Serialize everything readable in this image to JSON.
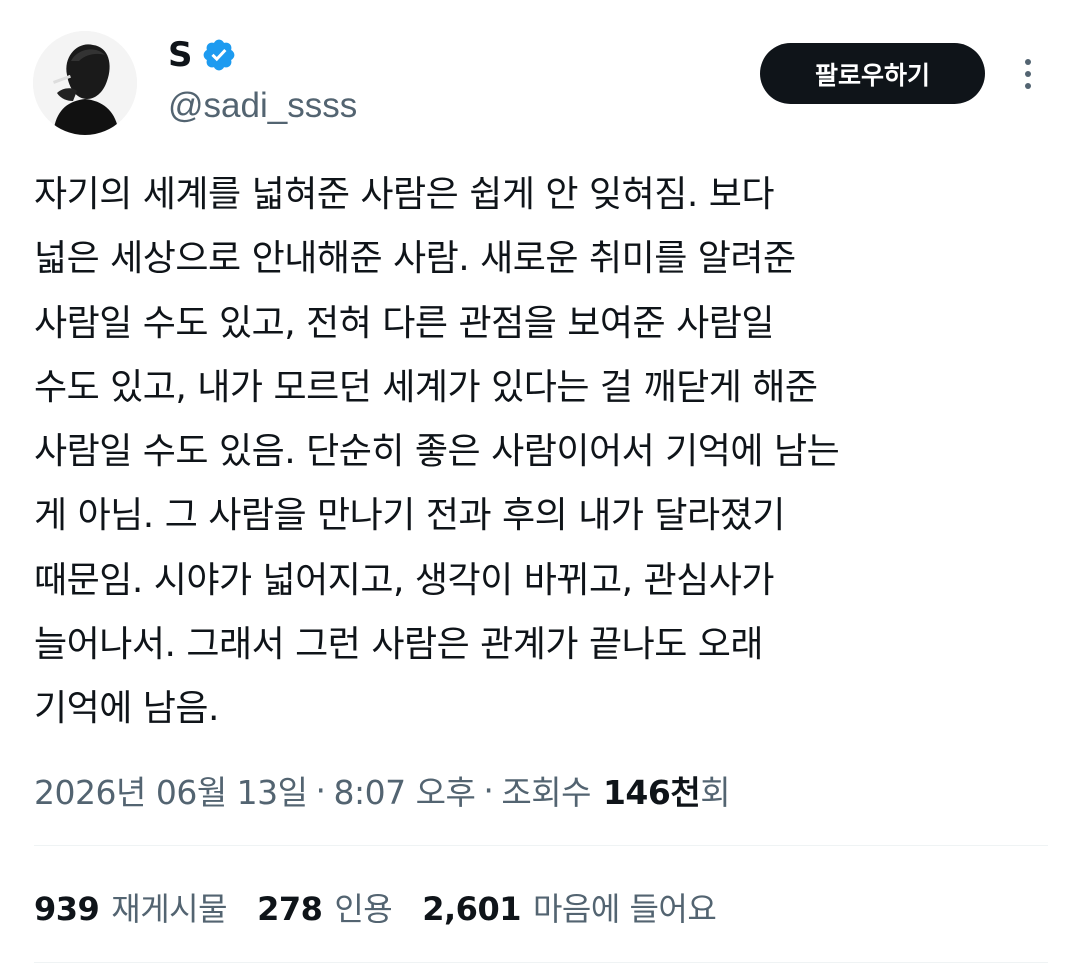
{
  "author": {
    "display_name": "S",
    "handle": "@sadi_ssss",
    "verified": true,
    "verified_color": "#1d9bf0"
  },
  "header": {
    "follow_label": "팔로우하기",
    "more_icon": "more-vertical-icon"
  },
  "tweet": {
    "text": "자기의 세계를 넓혀준 사람은 쉽게 안 잊혀짐. 보다\n넓은 세상으로 안내해준 사람. 새로운 취미를 알려준\n사람일 수도 있고, 전혀 다른 관점을 보여준 사람일\n수도 있고, 내가 모르던 세계가 있다는 걸 깨닫게 해준\n사람일 수도 있음. 단순히 좋은 사람이어서 기억에 남는\n게 아님. 그 사람을 만나기 전과 후의 내가 달라졌기\n때문임. 시야가 넓어지고, 생각이 바뀌고, 관심사가\n늘어나서. 그래서 그런 사람은 관계가 끝나도 오래\n기억에 남음."
  },
  "meta": {
    "date": "2026년 06월 13일",
    "separator": "·",
    "time": "8:07 오후",
    "views_label": "조회수",
    "views_count": "146천",
    "views_suffix": "회"
  },
  "stats": {
    "retweets": {
      "count": "939",
      "label": "재게시물"
    },
    "quotes": {
      "count": "278",
      "label": "인용"
    },
    "likes": {
      "count": "2,601",
      "label": "마음에 들어요"
    }
  },
  "colors": {
    "text_primary": "#0f1419",
    "text_secondary": "#536471",
    "button_bg": "#0f1419",
    "divider": "#eff3f4"
  }
}
